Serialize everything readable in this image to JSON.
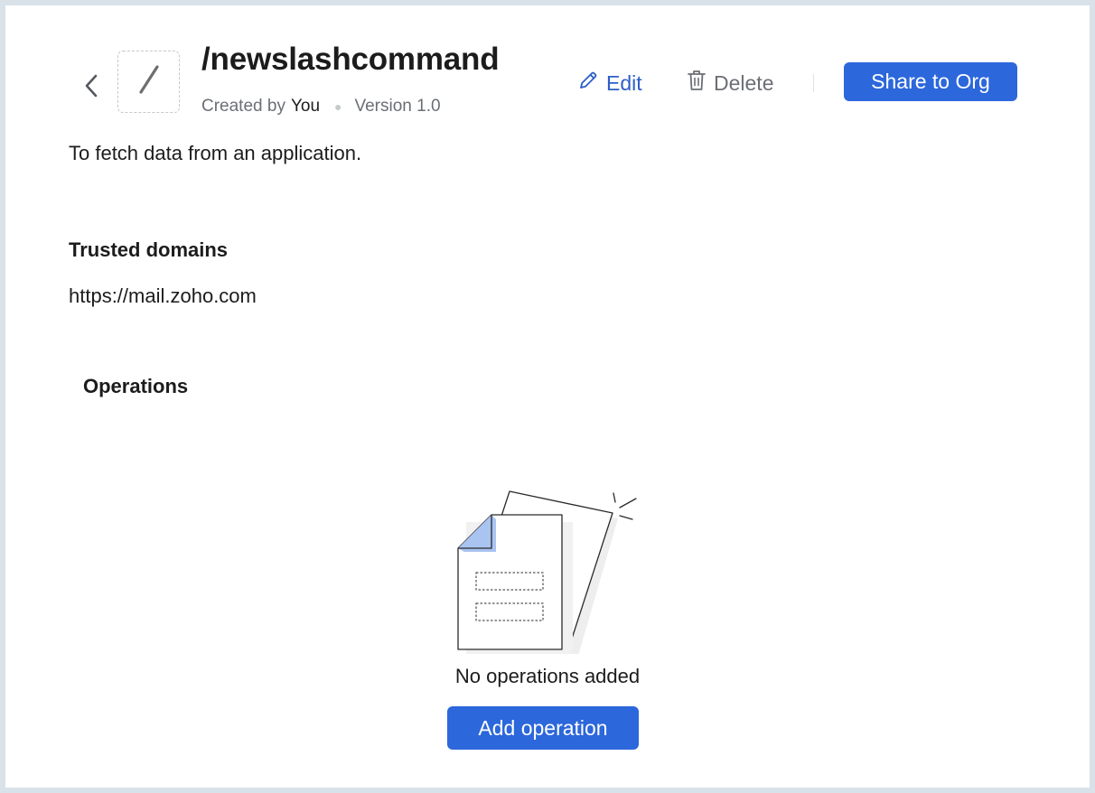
{
  "header": {
    "title": "/newslashcommand",
    "created_by_label": "Created by",
    "created_by_value": "You",
    "version": "Version 1.0",
    "back_icon": "chevron-left-icon",
    "command_icon": "slash-icon"
  },
  "actions": {
    "edit_label": "Edit",
    "edit_icon": "pencil-icon",
    "delete_label": "Delete",
    "delete_icon": "trash-icon",
    "share_label": "Share to Org"
  },
  "description": "To fetch data from an application.",
  "trusted_domains": {
    "title": "Trusted domains",
    "value": "https://mail.zoho.com"
  },
  "operations": {
    "title": "Operations",
    "empty_message": "No operations added",
    "add_label": "Add operation",
    "empty_icon": "empty-documents-illustration"
  },
  "colors": {
    "primary": "#2c67db",
    "link": "#2c5ec8",
    "muted": "#6b6f75",
    "page_bg": "#d9e2e8"
  }
}
